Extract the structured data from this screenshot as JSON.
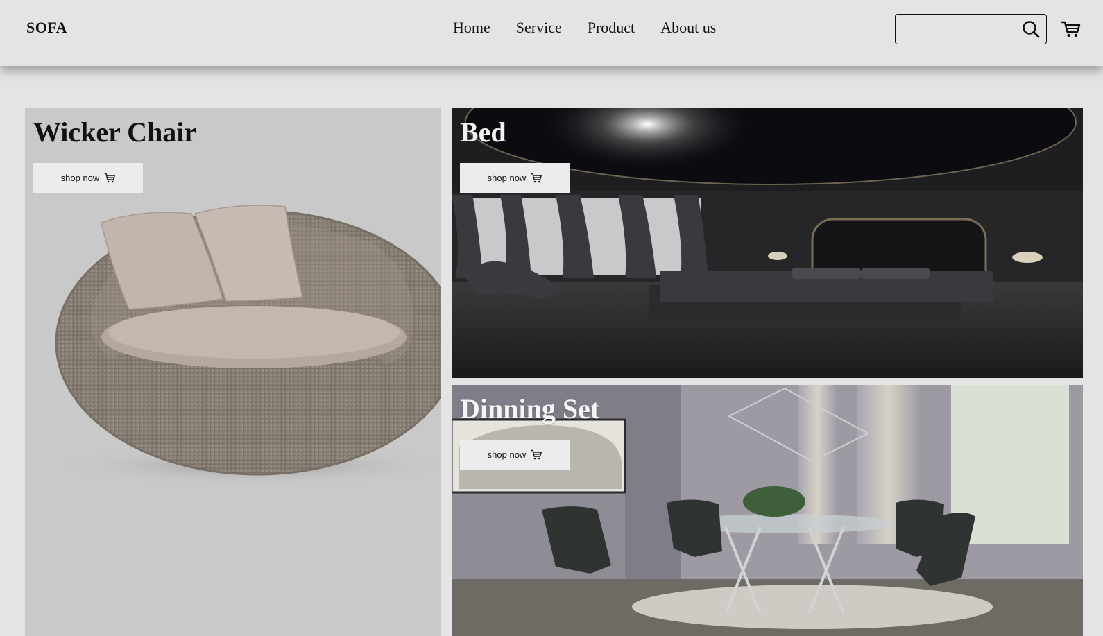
{
  "header": {
    "logo": "SOFA",
    "nav": [
      "Home",
      "Service",
      "Product",
      "About us"
    ],
    "search": {
      "placeholder": "",
      "value": ""
    }
  },
  "cards": [
    {
      "title": "Wicker Chair",
      "button_label": "shop now"
    },
    {
      "title": "Bed",
      "button_label": "shop now"
    },
    {
      "title": "Dinning Set",
      "button_label": "shop now"
    }
  ],
  "icons": {
    "search": "search-icon",
    "cart": "cart-icon"
  },
  "colors": {
    "background": "#e4e4e4",
    "wicker_panel": "#c9c9c9",
    "button_bg": "#ececec",
    "text": "#111111"
  }
}
